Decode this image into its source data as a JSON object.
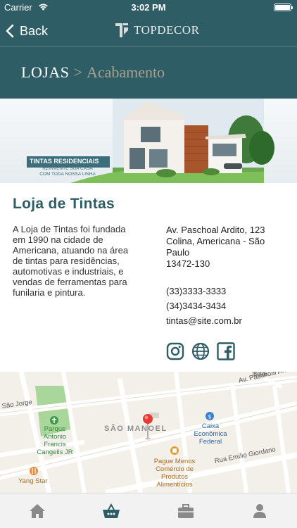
{
  "status_bar": {
    "carrier": "Carrier",
    "time": "3:02 PM"
  },
  "nav": {
    "back_label": "Back",
    "brand": "TOPDECOR"
  },
  "breadcrumb": {
    "root": "LOJAS",
    "separator": ">",
    "current": "Acabamento"
  },
  "banner": {
    "badge": "TINTAS RESIDENCIAIS",
    "subtitle": "REINVENTE SUA CASA COM TODA NOSSA LINHA"
  },
  "store": {
    "name": "Loja de Tintas",
    "description": "A Loja de Tintas foi fundada em 1990 na cidade de Americana, atuando na área de tintas para residências, automotivas e industriais, e vendas de ferramentas para funilaria e pintura.",
    "address": [
      "Av. Paschoal Ardito, 123",
      "Colina, Americana - São",
      "Paulo",
      "13472-130"
    ],
    "phones": [
      "(33)3333-3333",
      "(34)3434-3434"
    ],
    "email": "tintas@site.com.br",
    "social": [
      "instagram-icon",
      "globe-icon",
      "facebook-icon"
    ]
  },
  "map": {
    "streets": [
      "Av. Paschoal Ard",
      "São Jorge",
      "Rua Emílio Giordano",
      "Bolos"
    ],
    "district": "SÃO MANOEL",
    "pois": {
      "park": [
        "Parque",
        "Antonio",
        "Francis",
        "Cangelis JR"
      ],
      "bank": [
        "Caixa",
        "Econômica",
        "Federal"
      ],
      "store": [
        "Pague Menos",
        "Comércio de",
        "Produtos",
        "Alimentícios"
      ],
      "restaurant": "Yang Star"
    }
  },
  "tabs": [
    "home-icon",
    "basket-icon",
    "briefcase-icon",
    "user-icon"
  ],
  "colors": {
    "primary": "#2f5d66",
    "accent": "#a8a28e",
    "tab_active": "#2f5d66",
    "tab_inactive": "#8a8a8a"
  }
}
